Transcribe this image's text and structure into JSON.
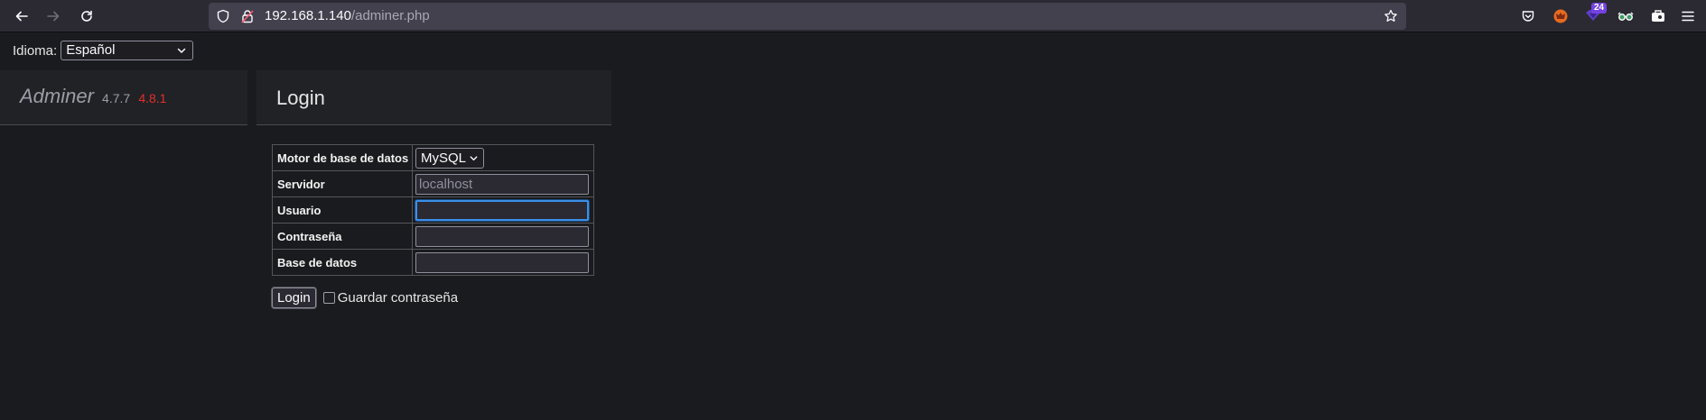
{
  "browser": {
    "url_host": "192.168.1.140",
    "url_path": "/adminer.php",
    "extension_badge": "24"
  },
  "page": {
    "language_label": "Idioma:",
    "language_selected": "Español",
    "brand": "Adminer",
    "version_current": "4.7.7",
    "version_new": "4.8.1",
    "heading": "Login",
    "form": {
      "engine_label": "Motor de base de datos",
      "engine_value": "MySQL",
      "server_label": "Servidor",
      "server_placeholder": "localhost",
      "user_label": "Usuario",
      "user_value": "",
      "password_label": "Contraseña",
      "password_value": "",
      "database_label": "Base de datos",
      "database_value": ""
    },
    "login_button": "Login",
    "remember_label": "Guardar contraseña"
  },
  "colors": {
    "background": "#1a1b1e",
    "panel": "#212226",
    "accent_new_version": "#e0302c",
    "focus": "#3c8ee7"
  }
}
